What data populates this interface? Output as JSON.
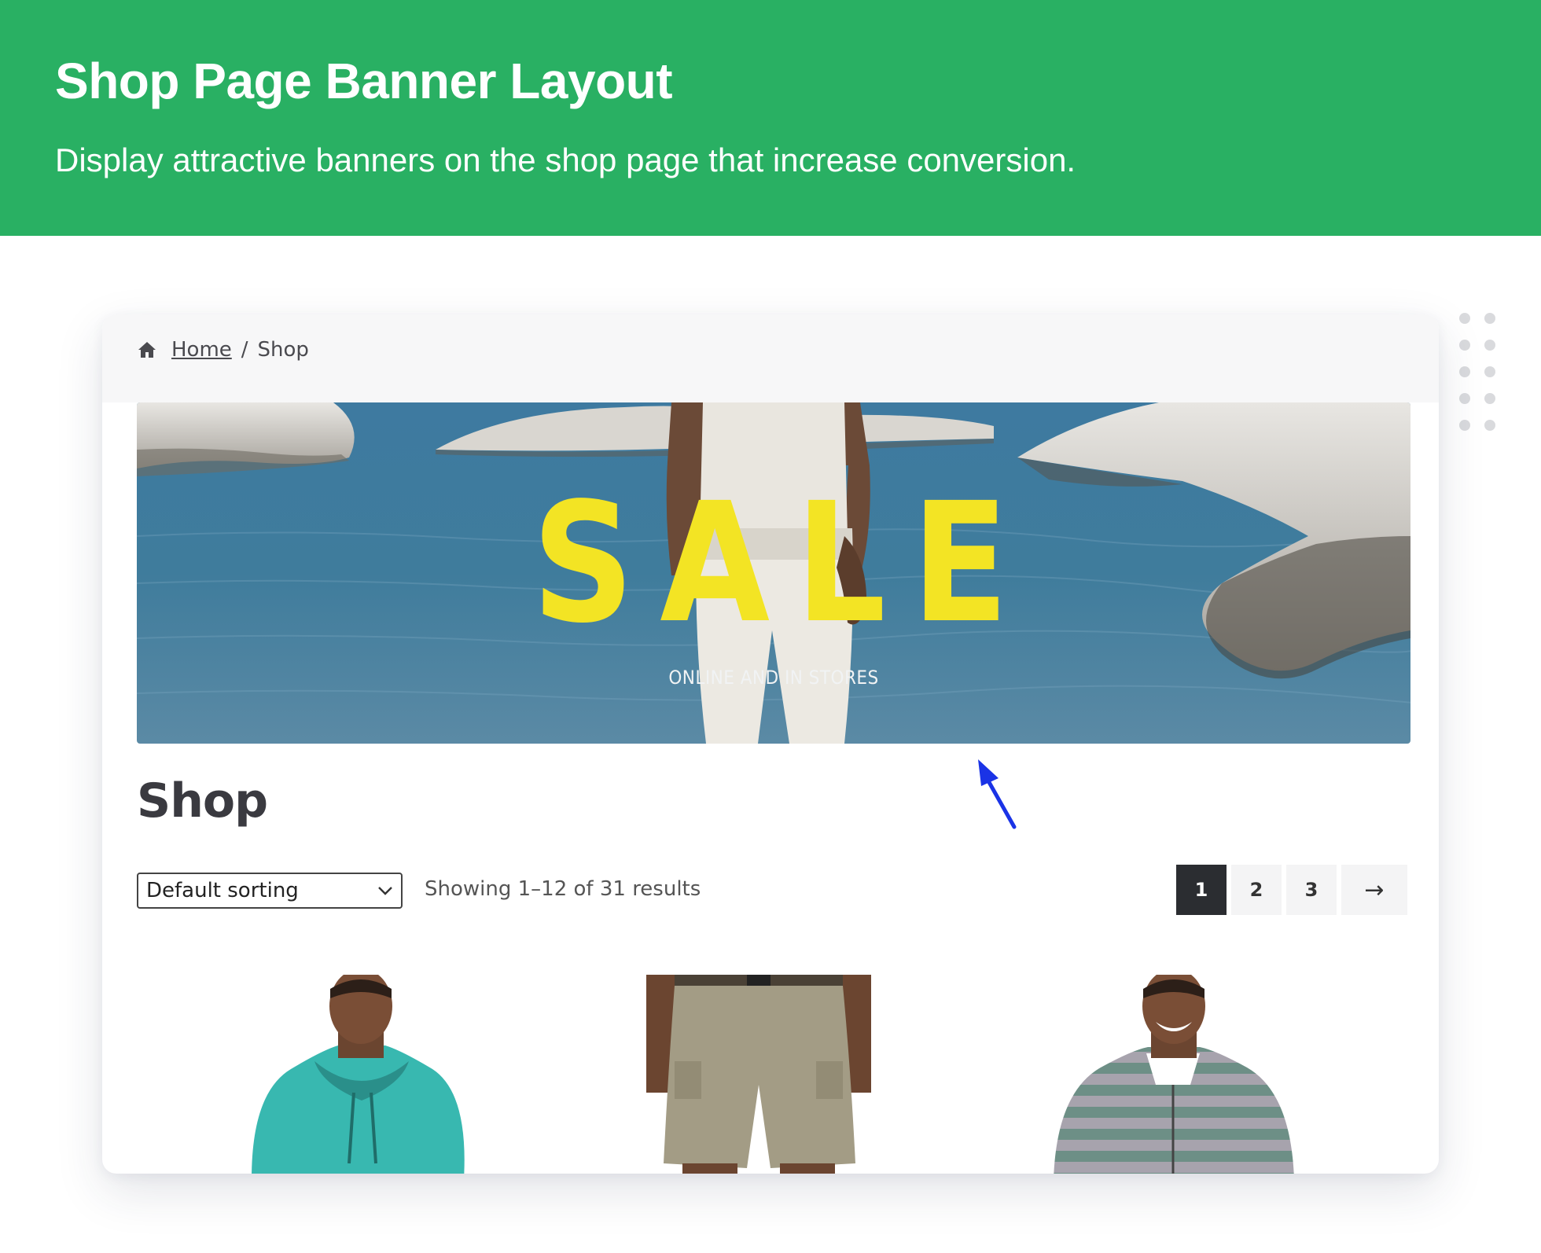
{
  "header": {
    "title": "Shop Page Banner Layout",
    "subtitle": "Display attractive banners on the shop page that increase conversion.",
    "background_color": "#29b063"
  },
  "breadcrumb": {
    "icon": "home-icon",
    "home_label": "Home",
    "separator": "/",
    "current": "Shop"
  },
  "banner": {
    "headline": "SALE",
    "subline": "ONLINE AND IN STORES",
    "headline_color": "#f3e424"
  },
  "page_title": "Shop",
  "toolbar": {
    "sort_selected": "Default sorting",
    "result_count": "Showing 1–12 of 31 results"
  },
  "pagination": {
    "pages": [
      "1",
      "2",
      "3"
    ],
    "current": "1",
    "next_label": "→"
  },
  "products": [
    {
      "name": "teal-hoodie-product-image"
    },
    {
      "name": "khaki-cargo-shorts-product-image"
    },
    {
      "name": "striped-hoodie-product-image"
    }
  ],
  "annotation": {
    "icon": "pointer-arrow-icon",
    "color": "#1a33e6"
  }
}
